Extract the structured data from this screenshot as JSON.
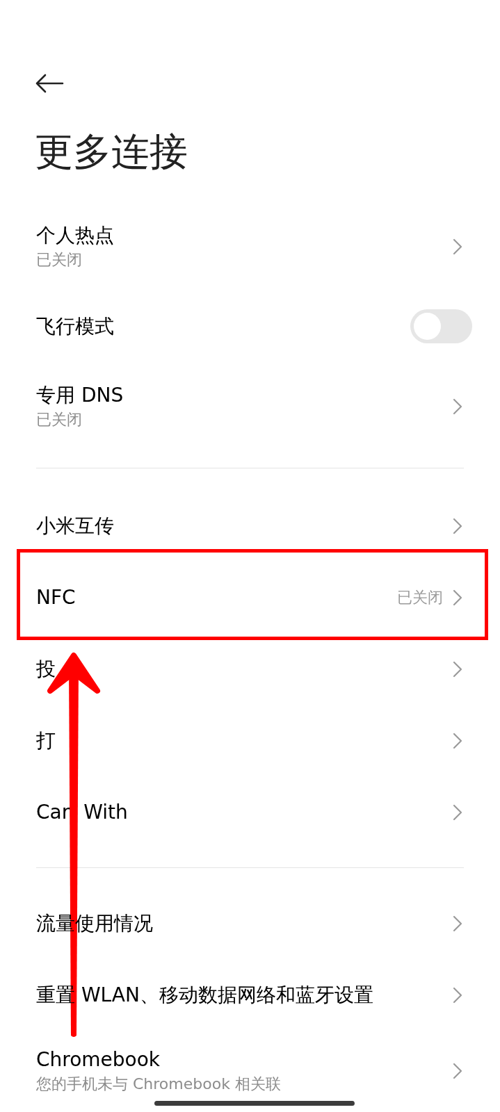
{
  "title": "更多连接",
  "sections": [
    [
      {
        "kind": "link",
        "label": "个人热点",
        "subtitle": "已关闭"
      },
      {
        "kind": "toggle",
        "label": "飞行模式",
        "on": false
      },
      {
        "kind": "link",
        "label": "专用 DNS",
        "subtitle": "已关闭"
      }
    ],
    [
      {
        "kind": "link",
        "label": "小米互传"
      },
      {
        "kind": "link",
        "label": "NFC",
        "value": "已关闭"
      },
      {
        "kind": "link",
        "label": "投"
      },
      {
        "kind": "link",
        "label": "打"
      },
      {
        "kind": "link",
        "label": "Car",
        "label_tail": "With"
      }
    ],
    [
      {
        "kind": "link",
        "label": "流量使用情况"
      },
      {
        "kind": "link",
        "label": "重置 WLAN、移动数据网络和蓝牙设置"
      },
      {
        "kind": "link",
        "label": "Chromebook",
        "subtitle": "您的手机未与 Chromebook 相关联"
      }
    ]
  ]
}
